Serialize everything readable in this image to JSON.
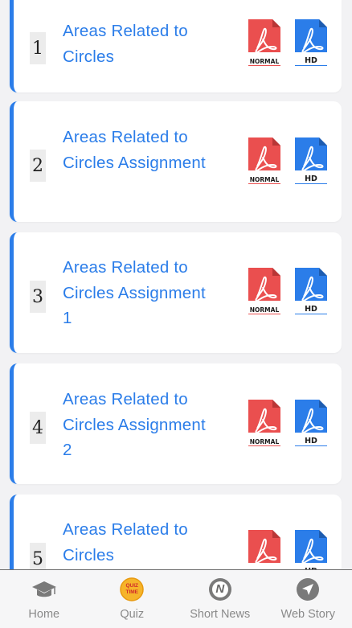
{
  "items": [
    {
      "number": "1",
      "title": "Areas Related to Circles"
    },
    {
      "number": "2",
      "title": "Areas Related to Circles Assignment"
    },
    {
      "number": "3",
      "title": "Areas Related to Circles Assignment 1"
    },
    {
      "number": "4",
      "title": "Areas Related to Circles Assignment 2"
    },
    {
      "number": "5",
      "title": "Areas Related to Circles"
    }
  ],
  "pdf_buttons": {
    "normal_label": "NORMAL",
    "hd_label": "HD",
    "normal_color": "#ea4f4f",
    "hd_color": "#2b7de9"
  },
  "bottom_nav": [
    {
      "label": "Home",
      "icon": "graduation-cap-icon"
    },
    {
      "label": "Quiz",
      "icon": "quiz-time-icon",
      "icon_text": "QUIZ TIME"
    },
    {
      "label": "Short News",
      "icon": "news-icon",
      "icon_text": "N"
    },
    {
      "label": "Web Story",
      "icon": "web-story-icon"
    }
  ]
}
